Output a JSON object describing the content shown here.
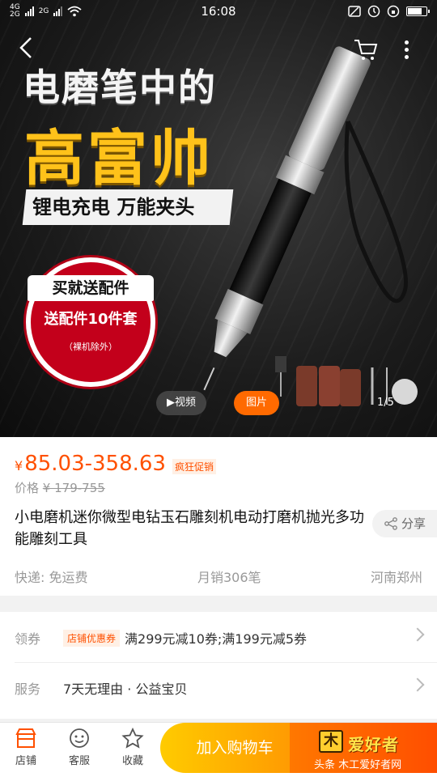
{
  "status_bar": {
    "time": "16:08",
    "net_top": "4G",
    "net_bottom": "2G",
    "net2": "2G"
  },
  "hero": {
    "headline1": "电磨笔中的",
    "headline2": "高富帅",
    "ribbon": "锂电充电 万能夹头",
    "promo_top": "买就送配件",
    "promo_mid": "送配件10件套",
    "promo_bot": "（裸机除外）",
    "video_label": "▶视频",
    "photo_label": "图片",
    "page_indicator": "1/5",
    "colors": {
      "gold": "#ffc21a",
      "promo_red": "#c3001b",
      "accent": "#ff6a00"
    }
  },
  "price": {
    "currency": "¥",
    "value": "85.03-358.63",
    "tag": "疯狂促销",
    "orig_label": "价格",
    "orig_value": "¥ 179-755"
  },
  "product": {
    "title": "小电磨机迷你微型电钻玉石雕刻机电动打磨机抛光多功能雕刻工具",
    "share": "分享"
  },
  "meta": {
    "shipping": "快递: 免运费",
    "sales": "月销306笔",
    "location": "河南郑州"
  },
  "coupon": {
    "label": "领券",
    "badge": "店铺优惠券",
    "text": "满299元减10券;满199元减5券"
  },
  "service": {
    "label": "服务",
    "text": "7天无理由 · 公益宝贝"
  },
  "bottom_bar": {
    "shop": "店铺",
    "support": "客服",
    "favorite": "收藏",
    "add_cart": "加入购物车"
  },
  "watermark": {
    "logo": "木",
    "title": "爱好者",
    "caption": "头条 木工爱好者网"
  }
}
